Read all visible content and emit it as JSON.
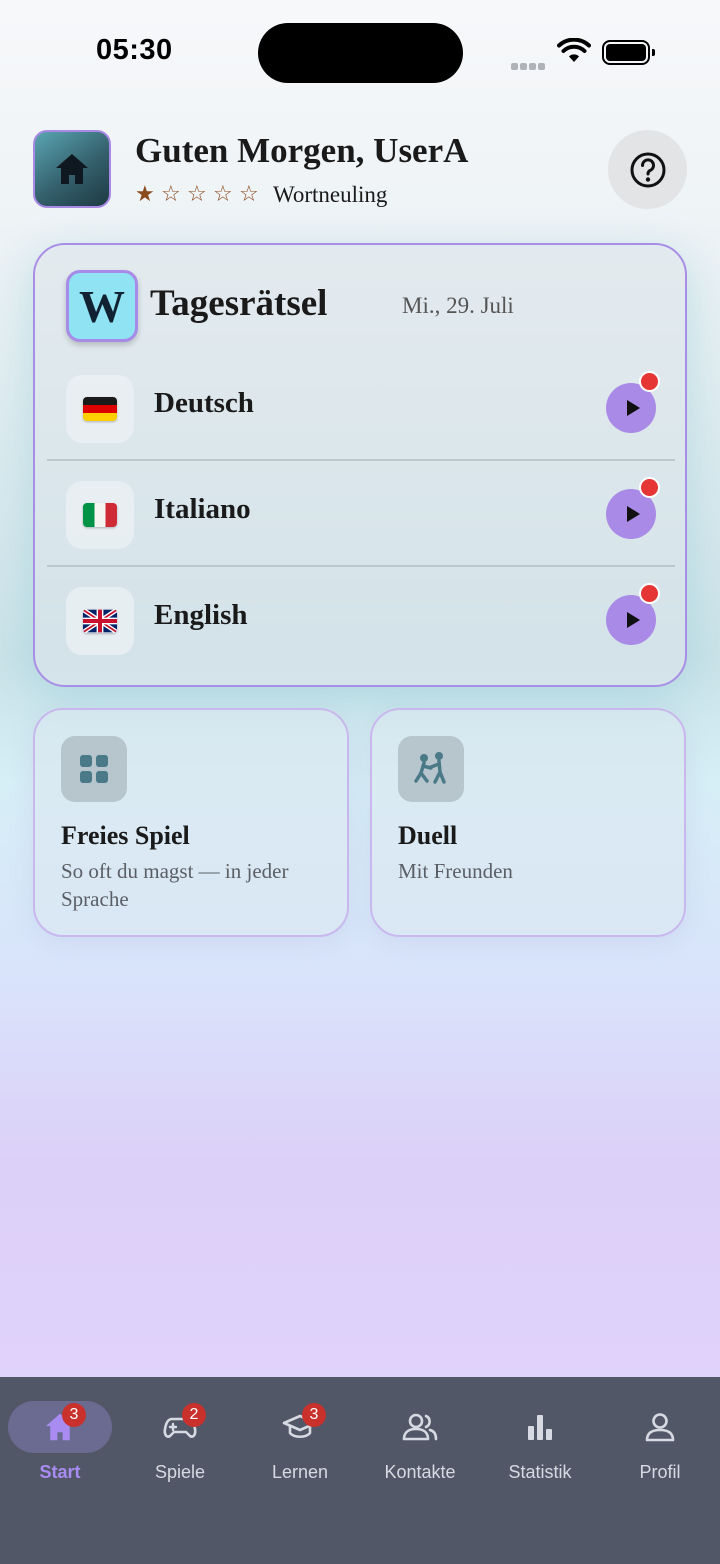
{
  "status_bar": {
    "time": "05:30"
  },
  "header": {
    "greeting": "Guten Morgen, UserA",
    "rating": {
      "filled": 1,
      "total": 5
    },
    "rank": "Wortneuling"
  },
  "daily": {
    "logo_letter": "W",
    "title": "Tagesrätsel",
    "date": "Mi., 29. Juli",
    "languages": [
      {
        "name": "Deutsch",
        "flag": "flag-de"
      },
      {
        "name": "Italiano",
        "flag": "flag-it"
      },
      {
        "name": "English",
        "flag": "flag-gb"
      }
    ]
  },
  "tiles": [
    {
      "title": "Freies Spiel",
      "subtitle": "So oft du magst — in jeder Sprache",
      "icon": "grid-icon"
    },
    {
      "title": "Duell",
      "subtitle": "Mit Freunden",
      "icon": "duel-icon"
    }
  ],
  "tabs": [
    {
      "label": "Start",
      "badge": "3",
      "icon": "home-icon"
    },
    {
      "label": "Spiele",
      "badge": "2",
      "icon": "gamepad-icon"
    },
    {
      "label": "Lernen",
      "badge": "3",
      "icon": "graduation-cap-icon"
    },
    {
      "label": "Kontakte",
      "icon": "contacts-icon"
    },
    {
      "label": "Statistik",
      "icon": "bar-chart-icon"
    },
    {
      "label": "Profil",
      "icon": "person-icon"
    }
  ],
  "colors": {
    "accent": "#a98ae6",
    "tab_bar": "#525767",
    "badge": "#c8312c",
    "notify": "#e53535"
  }
}
